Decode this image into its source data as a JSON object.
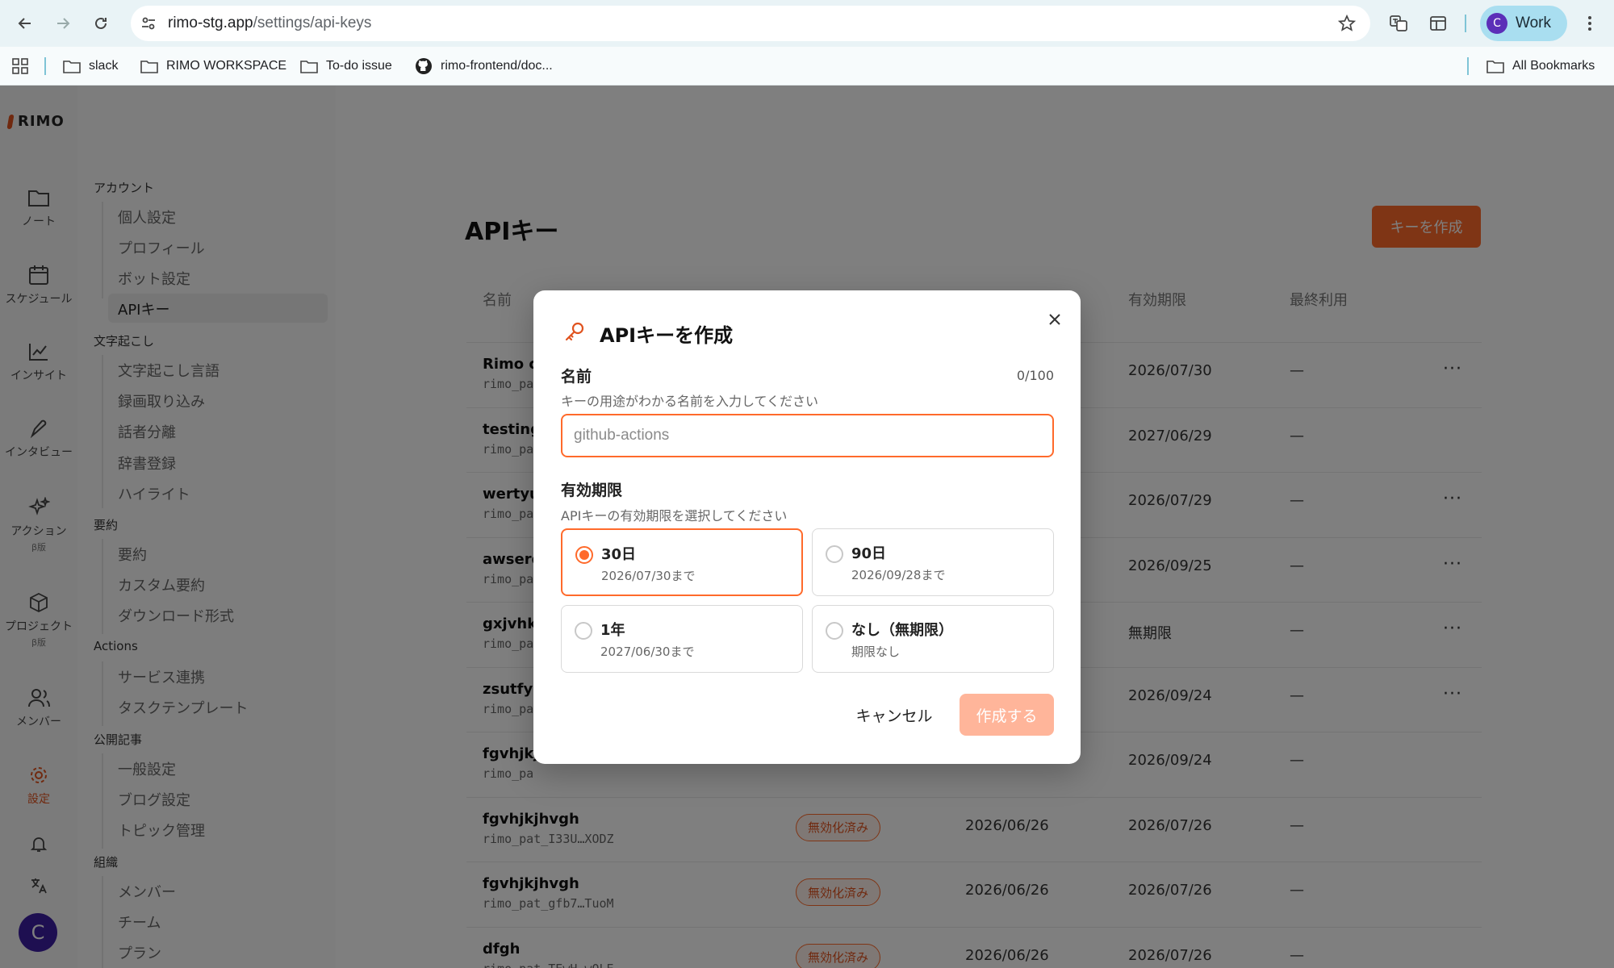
{
  "browser": {
    "url_host": "rimo-stg.app",
    "url_path": "/settings/api-keys",
    "profile_initial": "C",
    "profile_label": "Work",
    "bookmarks": [
      "slack",
      "RIMO WORKSPACE",
      "To-do issue",
      "rimo-frontend/doc..."
    ],
    "all_bookmarks": "All Bookmarks"
  },
  "app": {
    "logo": "RIMO",
    "rail": [
      {
        "label": "ノート",
        "icon": "folder-icon"
      },
      {
        "label": "スケジュール",
        "icon": "calendar-icon"
      },
      {
        "label": "インサイト",
        "icon": "chart-icon"
      },
      {
        "label": "インタビュー",
        "icon": "pen-icon"
      },
      {
        "label": "アクション",
        "beta": "β版",
        "icon": "sparkle-icon"
      },
      {
        "label": "プロジェクト",
        "beta": "β版",
        "icon": "cube-icon"
      },
      {
        "label": "メンバー",
        "icon": "members-icon"
      },
      {
        "label": "設定",
        "icon": "gear-icon"
      }
    ],
    "user_initial": "C",
    "settings_nav": {
      "account": "アカウント",
      "account_items": [
        "個人設定",
        "プロフィール",
        "ボット設定",
        "APIキー"
      ],
      "transcription": "文字起こし",
      "transcription_items": [
        "文字起こし言語",
        "録画取り込み",
        "話者分離",
        "辞書登録",
        "ハイライト"
      ],
      "summary": "要約",
      "summary_items": [
        "要約",
        "カスタム要約",
        "ダウンロード形式"
      ],
      "actions": "Actions",
      "actions_items": [
        "サービス連携",
        "タスクテンプレート"
      ],
      "public": "公開記事",
      "public_items": [
        "一般設定",
        "ブログ設定",
        "トピック管理"
      ],
      "org": "組織",
      "org_items": [
        "メンバー",
        "チーム",
        "プラン"
      ]
    },
    "page_title": "APIキー",
    "create_key_label": "キーを作成",
    "table": {
      "headers": {
        "name": "名前",
        "expires": "有効期限",
        "last_used": "最終利用"
      },
      "rows": [
        {
          "name": "Rimo cl",
          "prefix": "rimo_pa",
          "status": "",
          "created": "",
          "expires": "2026/07/30",
          "last_used": "—",
          "menu": "···"
        },
        {
          "name": "testing",
          "prefix": "rimo_pa",
          "status": "",
          "created": "",
          "expires": "2027/06/29",
          "last_used": "—",
          "menu": ""
        },
        {
          "name": "wertyui",
          "prefix": "rimo_pa",
          "status": "",
          "created": "",
          "expires": "2026/07/29",
          "last_used": "—",
          "menu": "···"
        },
        {
          "name": "awserd",
          "prefix": "rimo_pa",
          "status": "",
          "created": "",
          "expires": "2026/09/25",
          "last_used": "—",
          "menu": "···"
        },
        {
          "name": "gxjvhkb",
          "prefix": "rimo_pa",
          "status": "",
          "created": "",
          "expires": "無期限",
          "last_used": "—",
          "menu": "···"
        },
        {
          "name": "zsutfyh",
          "prefix": "rimo_pa",
          "status": "",
          "created": "",
          "expires": "2026/09/24",
          "last_used": "—",
          "menu": "···"
        },
        {
          "name": "fgvhjkjl",
          "prefix": "rimo_pa",
          "status": "",
          "created": "",
          "expires": "2026/09/24",
          "last_used": "—",
          "menu": ""
        },
        {
          "name": "fgvhjkjhvgh",
          "prefix": "rimo_pat_I33U…XODZ",
          "status": "無効化済み",
          "created": "2026/06/26",
          "expires": "2026/07/26",
          "last_used": "—",
          "menu": ""
        },
        {
          "name": "fgvhjkjhvgh",
          "prefix": "rimo_pat_gfb7…TuoM",
          "status": "無効化済み",
          "created": "2026/06/26",
          "expires": "2026/07/26",
          "last_used": "—",
          "menu": ""
        },
        {
          "name": "dfgh",
          "prefix": "rimo_pat_TEwH…wQLE",
          "status": "無効化済み",
          "created": "2026/06/26",
          "expires": "2026/07/26",
          "last_used": "—",
          "menu": ""
        }
      ]
    }
  },
  "modal": {
    "title": "APIキーを作成",
    "name_label": "名前",
    "name_counter": "0/100",
    "name_helper": "キーの用途がわかる名前を入力してください",
    "name_placeholder": "github-actions",
    "name_value": "",
    "expiry_label": "有効期限",
    "expiry_helper": "APIキーの有効期限を選択してください",
    "options": [
      {
        "title": "30日",
        "sub": "2026/07/30まで",
        "selected": true
      },
      {
        "title": "90日",
        "sub": "2026/09/28まで",
        "selected": false
      },
      {
        "title": "1年",
        "sub": "2027/06/30まで",
        "selected": false
      },
      {
        "title": "なし（無期限）",
        "sub": "期限なし",
        "selected": false
      }
    ],
    "cancel_label": "キャンセル",
    "submit_label": "作成する"
  },
  "colors": {
    "accent": "#ff6a2b",
    "accent_disabled": "#ffb59a",
    "chrome_bg": "#e9f3f6",
    "profile_bg": "#a9def0",
    "avatar": "#5b2fb8"
  }
}
